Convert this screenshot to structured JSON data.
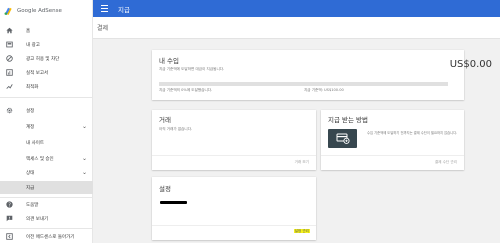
{
  "brand": {
    "name": "Google AdSense"
  },
  "topbar": {
    "title": "지급"
  },
  "page": {
    "title": "결제"
  },
  "sidebar": {
    "items": [
      {
        "label": "홈",
        "icon": "home-icon"
      },
      {
        "label": "내 광고",
        "icon": "ads-icon"
      },
      {
        "label": "광고 허용 및 차단",
        "icon": "block-icon"
      },
      {
        "label": "실적 보고서",
        "icon": "report-icon"
      },
      {
        "label": "최적화",
        "icon": "optimize-icon"
      },
      {
        "label": "설정",
        "icon": "gear-icon"
      },
      {
        "label": "계정",
        "icon": "",
        "chevron": true
      },
      {
        "label": "내 사이트",
        "icon": ""
      },
      {
        "label": "액세스 및 승인",
        "icon": "",
        "chevron": true
      },
      {
        "label": "상태",
        "icon": "",
        "chevron": true
      },
      {
        "label": "지급",
        "icon": "",
        "active": true
      },
      {
        "label": "도움말",
        "icon": "help-icon"
      },
      {
        "label": "의견 보내기",
        "icon": "feedback-icon"
      },
      {
        "label": "이전 애드센스로 돌아가기",
        "icon": "back-icon"
      }
    ]
  },
  "earnings_card": {
    "title": "내 수입",
    "description": "지급 기준액에 도달하면 대금이 지급됩니다.",
    "amount": "US$0.00",
    "progress": 0.0,
    "left_caption": "지급 기준액의 0%에 도달했습니다.",
    "right_caption": "지급 기준액: US$100.00"
  },
  "transactions_card": {
    "title": "거래",
    "description": "아직 거래가 없습니다.",
    "link": "거래 보기"
  },
  "payment_method_card": {
    "title": "지급 받는 방법",
    "description": "수입 기준액에 도달하기 전까지는 결제 수단이 필요하지 않습니다.",
    "link": "결제 수단 관리"
  },
  "settings_card": {
    "title": "설정",
    "link": "설정 관리"
  },
  "colors": {
    "topbar": "#2f6bd5",
    "highlight": "#f6f21b",
    "pay_icon_bg": "#37474f"
  }
}
